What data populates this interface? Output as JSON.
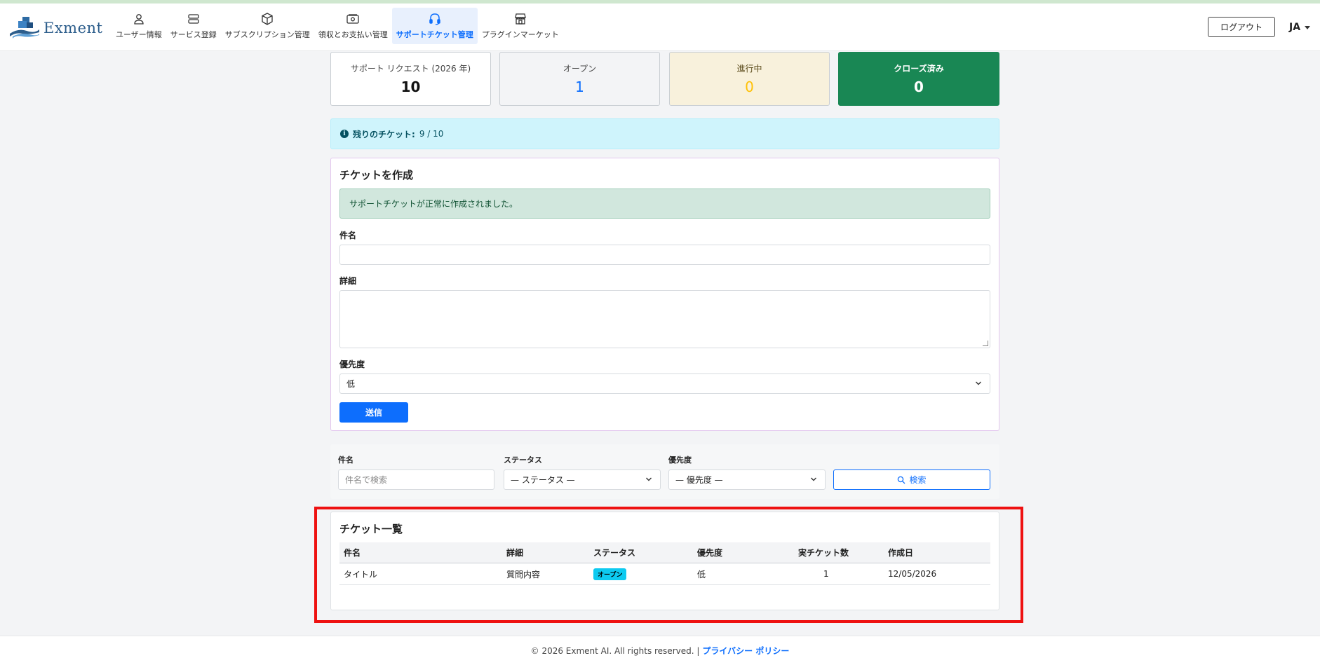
{
  "brand": {
    "name": "Exment"
  },
  "nav": [
    {
      "label": "ユーザー情報",
      "icon": "user-icon"
    },
    {
      "label": "サービス登録",
      "icon": "server-icon"
    },
    {
      "label": "サブスクリプション管理",
      "icon": "box-icon"
    },
    {
      "label": "領収とお支払い管理",
      "icon": "cash-icon"
    },
    {
      "label": "サポートチケット管理",
      "icon": "headset-icon",
      "active": true
    },
    {
      "label": "プラグインマーケット",
      "icon": "shop-icon"
    }
  ],
  "header": {
    "logout_label": "ログアウト",
    "language": "JA"
  },
  "stats": [
    {
      "title": "サポート リクエスト (2026 年)",
      "value": "10"
    },
    {
      "title": "オープン",
      "value": "1"
    },
    {
      "title": "進行中",
      "value": "0"
    },
    {
      "title": "クローズ済み",
      "value": "0"
    }
  ],
  "remaining": {
    "label": "残りのチケット:",
    "value": "9 / 10"
  },
  "create_form": {
    "title": "チケットを作成",
    "success_message": "サポートチケットが正常に作成されました。",
    "subject_label": "件名",
    "subject_value": "",
    "detail_label": "詳細",
    "detail_value": "",
    "priority_label": "優先度",
    "priority_value": "低",
    "submit_label": "送信"
  },
  "filter": {
    "subject_label": "件名",
    "subject_placeholder": "件名で検索",
    "status_label": "ステータス",
    "status_value": "— ステータス —",
    "priority_label": "優先度",
    "priority_value": "— 優先度 —",
    "search_label": "検索"
  },
  "ticket_list": {
    "title": "チケット一覧",
    "columns": [
      "件名",
      "詳細",
      "ステータス",
      "優先度",
      "実チケット数",
      "作成日"
    ],
    "rows": [
      {
        "subject": "タイトル",
        "detail": "質問内容",
        "status": "オープン",
        "priority": "低",
        "count": "1",
        "created": "12/05/2026"
      }
    ]
  },
  "footer": {
    "copyright": "© 2026 Exment AI. All rights reserved. |",
    "privacy_label": "プライバシー ポリシー"
  },
  "colors": {
    "primary": "#0d6efd",
    "success": "#198754",
    "warning": "#ffc107",
    "info_bg": "#cff4fc",
    "badge_open": "#0dcaf0",
    "highlight": "#ee1111"
  }
}
